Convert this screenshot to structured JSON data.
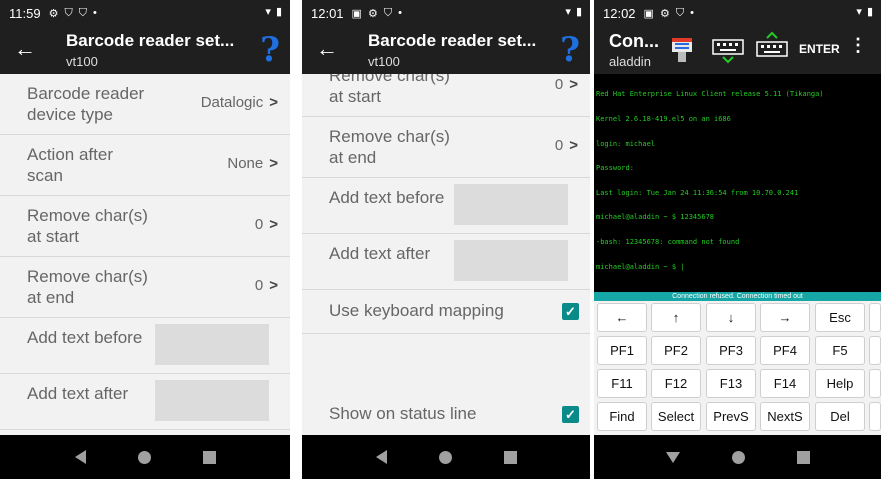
{
  "screen1": {
    "status": {
      "time": "11:59"
    },
    "title": "Barcode reader set...",
    "subtitle": "vt100",
    "rows": [
      {
        "label_l1": "Barcode reader",
        "label_l2": "device type",
        "value": "Datalogic",
        "chevron": ">"
      },
      {
        "label_l1": "Action after",
        "label_l2": "scan",
        "value": "None",
        "chevron": ">"
      },
      {
        "label_l1": "Remove char(s)",
        "label_l2": "at start",
        "value": "0",
        "chevron": ">"
      },
      {
        "label_l1": "Remove char(s)",
        "label_l2": "at end",
        "value": "0",
        "chevron": ">"
      },
      {
        "label": "Add text before"
      },
      {
        "label": "Add text after"
      }
    ]
  },
  "screen2": {
    "status": {
      "time": "12:01"
    },
    "title": "Barcode reader set...",
    "subtitle": "vt100",
    "rows": [
      {
        "label_l1": "Remove char(s)",
        "label_l2": "at start",
        "value": "0",
        "chevron": ">"
      },
      {
        "label_l1": "Remove char(s)",
        "label_l2": "at end",
        "value": "0",
        "chevron": ">"
      },
      {
        "label": "Add text before"
      },
      {
        "label": "Add text after"
      },
      {
        "label": "Use keyboard mapping",
        "checked": true
      },
      {
        "label": "Show on status line",
        "checked": true
      }
    ],
    "check_mark": "✓"
  },
  "screen3": {
    "status": {
      "time": "12:02"
    },
    "title": "Con...",
    "subtitle": "aladdin",
    "enter_label": "ENTER",
    "terminal_lines": [
      "Red Hat Enterprise Linux Client release 5.11 (Tikanga)",
      "Kernel 2.6.18-419.el5 on an i686",
      "login: michael",
      "Password:",
      "Last login: Tue Jan 24 11:36:54 from 10.70.0.241",
      "michael@aladdin ~ $ 12345678",
      "-bash: 12345678: command not found",
      "michael@aladdin ~ $ |"
    ],
    "status_line": "Connection refused. Connection timed out",
    "keys": [
      [
        "←",
        "↑",
        "↓",
        "→",
        "Esc"
      ],
      [
        "PF1",
        "PF2",
        "PF3",
        "PF4",
        "F5"
      ],
      [
        "F11",
        "F12",
        "F13",
        "F14",
        "Help"
      ],
      [
        "Find",
        "Select",
        "PrevS",
        "NextS",
        "Del"
      ]
    ]
  },
  "colors": {
    "accent": "#0b8a8a",
    "help": "#1f6fe0",
    "terminal_text": "#22cc22",
    "status_line": "#16a6a6"
  }
}
